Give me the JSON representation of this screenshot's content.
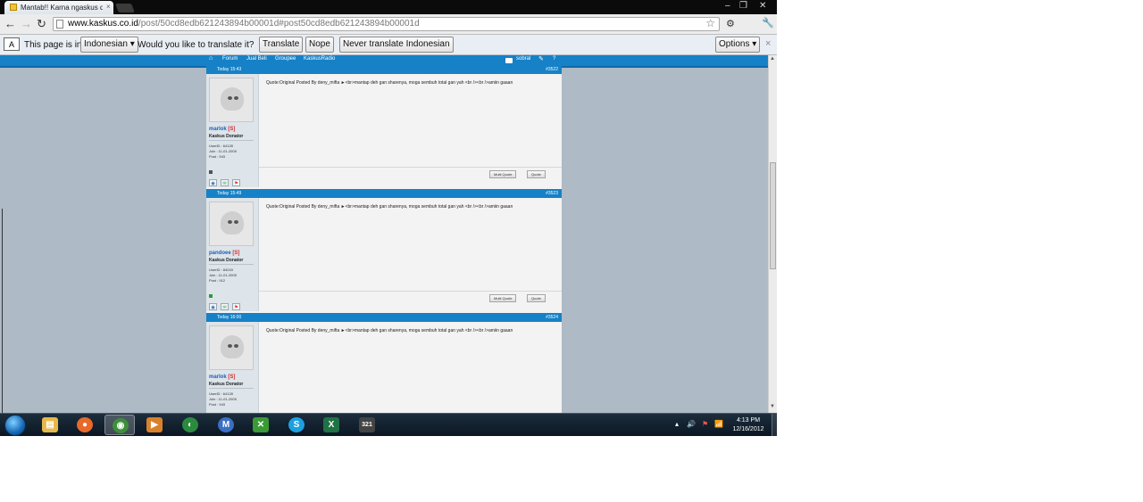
{
  "browser": {
    "tab_title": "Mantab!! Karna ngaskus di",
    "tab_close": "×",
    "url_host": "www.kaskus.co.id",
    "url_path": "/post/50cd8edb621243894b00001d#post50cd8edb621243894b00001d",
    "window_controls": [
      "–",
      "❐",
      "✕"
    ],
    "nav_icons": [
      "back-arrow-icon",
      "forward-arrow-icon",
      "reload-icon"
    ]
  },
  "translate_bar": {
    "prefix": "This page is in",
    "language": "Indonesian ▾",
    "question": "Would you like to translate it?",
    "translate": "Translate",
    "nope": "Nope",
    "never": "Never translate Indonesian",
    "options": "Options ▾",
    "close": "×"
  },
  "site_nav": {
    "home": "⌂",
    "items": [
      "Forum",
      "Jual Beli",
      "Groupee",
      "KaskusRadio"
    ],
    "user": "sobral",
    "edit_icon": "✎",
    "help_icon": "?"
  },
  "posts": [
    {
      "date": "Today 15:43",
      "number": "#3522",
      "username": "marlok",
      "flag": "[S]",
      "rank": "Kaskus Donator",
      "stats": [
        "UserID   : 64128",
        "Join     : 11-01-2005",
        "Post     : 943"
      ],
      "status_color": "#4b5563",
      "body": "Quote:Original Posted By deny_mifta ►<br>mantap deh gan sharenya, moga sembuh total gan yah <br /><br />amiin gaaan",
      "multi_quote": "Multi Quote",
      "quote": "Quote"
    },
    {
      "date": "Today 15:49",
      "number": "#3523",
      "username": "pandoee",
      "flag": "[S]",
      "rank": "Kaskus Donator",
      "stats": [
        "UserID   : 84043",
        "Join     : 11-01-2005",
        "Post     : 912"
      ],
      "status_color": "#2e9a3a",
      "body": "Quote:Original Posted By deny_mifta ►<br>mantap deh gan sharenya, moga sembuh total gan yah <br /><br />amiin gaaan",
      "multi_quote": "Multi Quote",
      "quote": "Quote"
    },
    {
      "date": "Today 16:00",
      "number": "#3524",
      "username": "marlok",
      "flag": "[S]",
      "rank": "Kaskus Donator",
      "stats": [
        "UserID   : 64128",
        "Join     : 11-01-2005",
        "Post     : 943"
      ],
      "status_color": "#4b5563",
      "body": "Quote:Original Posted By deny_mifta ►<br>mantap deh gan sharenya, moga sembuh total gan yah <br /><br />amiin gaaan",
      "multi_quote": "Multi Quote",
      "quote": "Quote"
    }
  ],
  "taskbar": {
    "apps": [
      {
        "name": "windows-explorer",
        "glyph": "▤",
        "color": "#e7b84a"
      },
      {
        "name": "firefox",
        "glyph": "●",
        "color": "#e8692a"
      },
      {
        "name": "chrome",
        "glyph": "◉",
        "color": "#3d8f3a"
      },
      {
        "name": "media-player",
        "glyph": "▶",
        "color": "#d9812a"
      },
      {
        "name": "internet-download",
        "glyph": "◐",
        "color": "#2b8a3e"
      },
      {
        "name": "maxthon",
        "glyph": "M",
        "color": "#3a6fc4"
      },
      {
        "name": "xbox",
        "glyph": "✕",
        "color": "#3a9a36"
      },
      {
        "name": "skype",
        "glyph": "S",
        "color": "#1ea0e0"
      },
      {
        "name": "excel",
        "glyph": "X",
        "color": "#207245"
      },
      {
        "name": "media-player-classic",
        "glyph": "321",
        "color": "#444444"
      }
    ],
    "tray": [
      "▴",
      "🔊",
      "⚑",
      "📶"
    ],
    "time": "4:13 PM",
    "date": "12/16/2012"
  },
  "colors": {
    "kaskus_blue": "#1681c6",
    "page_bg": "#aebac5",
    "username": "#1a5fb4"
  }
}
